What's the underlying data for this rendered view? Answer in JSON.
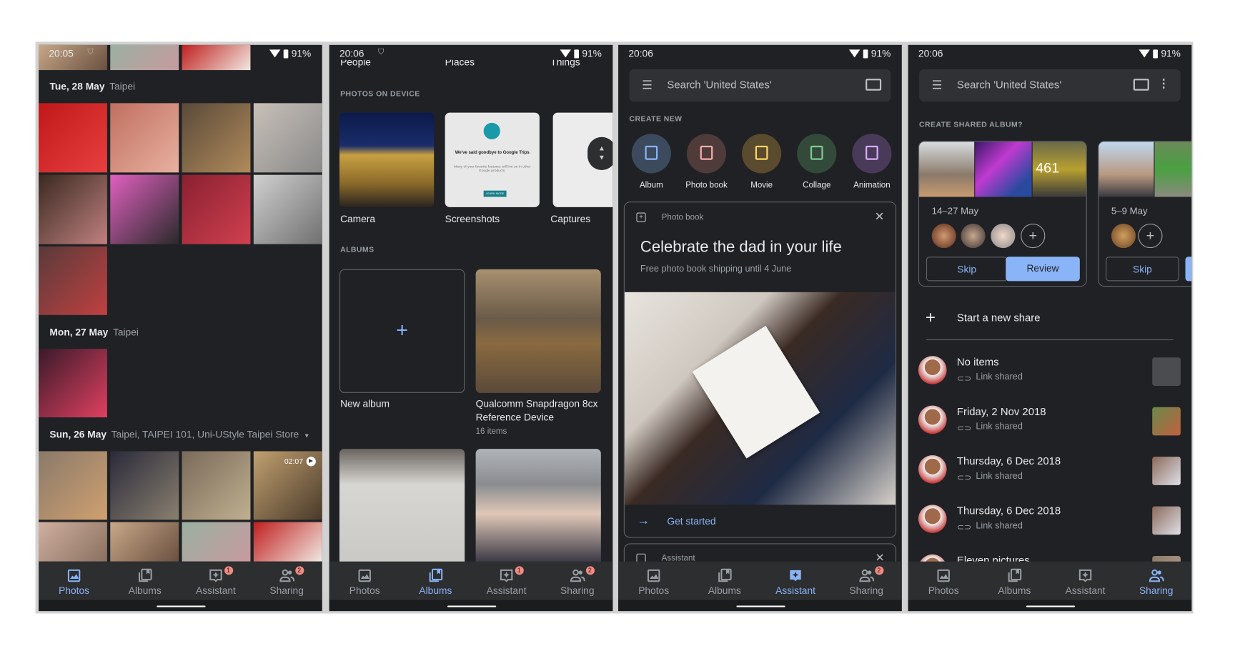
{
  "status": {
    "phone1": {
      "time": "20:05",
      "battery": "91%"
    },
    "phone2": {
      "time": "20:06",
      "battery": "91%"
    },
    "phone3": {
      "time": "20:06",
      "battery": "91%"
    },
    "phone4": {
      "time": "20:06",
      "battery": "91%"
    }
  },
  "nav": {
    "labels": [
      "Photos",
      "Albums",
      "Assistant",
      "Sharing"
    ],
    "icons": [
      "photo-icon",
      "albums-icon",
      "assistant-icon",
      "sharing-icon"
    ],
    "active": {
      "phone1": 0,
      "phone2": 1,
      "phone3": 2,
      "phone4": 3
    },
    "badges": {
      "phone1": {
        "assistant": "1",
        "sharing": "2"
      },
      "phone2": {
        "assistant": "1",
        "sharing": "2"
      },
      "phone3": {
        "sharing": "2"
      },
      "phone4": {}
    },
    "accent": "#8ab4f8"
  },
  "photos": {
    "groups": [
      {
        "date": "Tue, 28 May",
        "place": "Taipei"
      },
      {
        "date": "Mon, 27 May",
        "place": "Taipei"
      },
      {
        "date": "Sun, 26 May",
        "place": "Taipei, TAIPEI 101, Uni-UStyle Taipei Store"
      }
    ],
    "video_duration": "02:07"
  },
  "albums": {
    "top_categories": [
      "People",
      "Places",
      "Things"
    ],
    "device_section": "PHOTOS ON DEVICE",
    "device_folders": [
      "Camera",
      "Screenshots",
      "Captures"
    ],
    "screenshot_preview": {
      "title": "We've said goodbye to Google Trips",
      "body": "Many of your favorite features will live on in other Google products.",
      "button": "LEARN MORE"
    },
    "albums_section": "ALBUMS",
    "new_album": "New album",
    "album1": {
      "title_line1": "Qualcomm Snapdragon 8cx",
      "title_line2": "Reference Device",
      "count": "16 items"
    }
  },
  "assistant": {
    "search_placeholder": "Search 'United States'",
    "create_section": "CREATE NEW",
    "create_items": [
      {
        "label": "Album",
        "color": "#8ab4f8"
      },
      {
        "label": "Photo book",
        "color": "#f6aea9"
      },
      {
        "label": "Movie",
        "color": "#fdd663"
      },
      {
        "label": "Collage",
        "color": "#81c995"
      },
      {
        "label": "Animation",
        "color": "#d7aefb"
      }
    ],
    "card": {
      "type": "Photo book",
      "title": "Celebrate the dad in your life",
      "subtitle": "Free photo book shipping until 4 June",
      "action": "Get started"
    },
    "card2_type": "Assistant"
  },
  "sharing": {
    "search_placeholder": "Search 'United States'",
    "suggest_section": "CREATE SHARED ALBUM?",
    "suggestions": [
      {
        "dates": "14–27 May",
        "count": "461",
        "skip": "Skip",
        "review": "Review"
      },
      {
        "dates": "5–9 May",
        "skip": "Skip"
      }
    ],
    "start_new": "Start a new share",
    "shares": [
      {
        "title": "No items",
        "sub": "Link shared"
      },
      {
        "title": "Friday, 2 Nov 2018",
        "sub": "Link shared"
      },
      {
        "title": "Thursday, 6 Dec 2018",
        "sub": "Link shared"
      },
      {
        "title": "Thursday, 6 Dec 2018",
        "sub": "Link shared"
      },
      {
        "title": "Eleven pictures"
      }
    ]
  }
}
